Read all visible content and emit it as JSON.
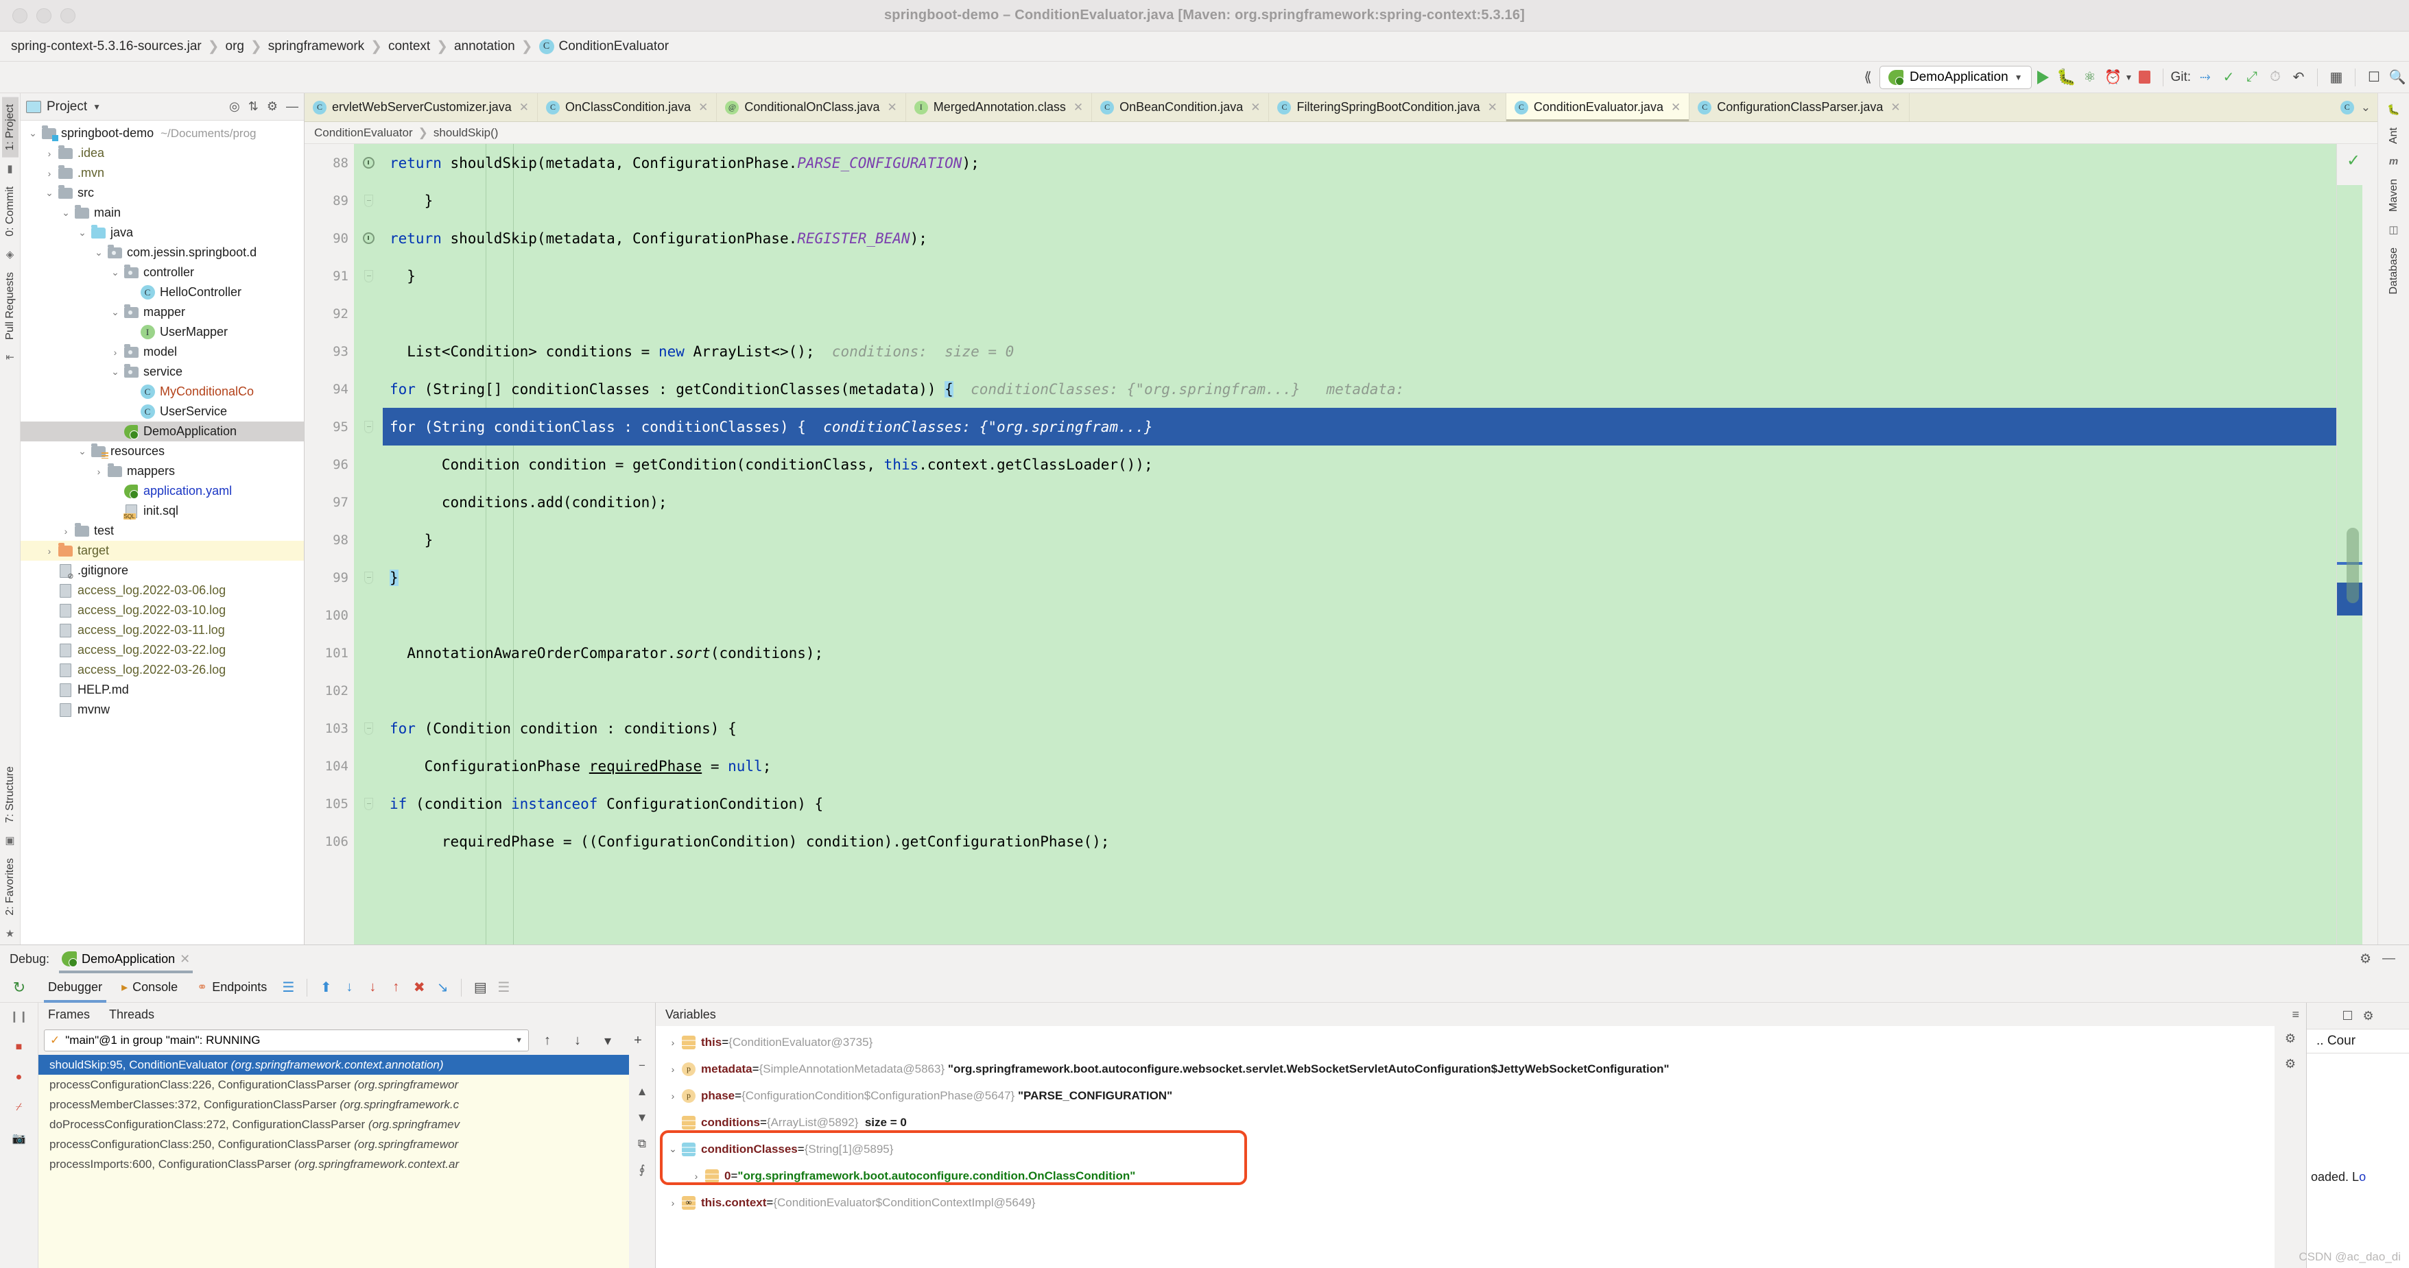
{
  "window": {
    "title": "springboot-demo – ConditionEvaluator.java [Maven: org.springframework:spring-context:5.3.16]"
  },
  "breadcrumb": {
    "items": [
      "spring-context-5.3.16-sources.jar",
      "org",
      "springframework",
      "context",
      "annotation",
      "ConditionEvaluator"
    ],
    "class_badge": "C"
  },
  "toolbar": {
    "run_config": "DemoApplication",
    "git_label": "Git:",
    "icons": {
      "run": "run-icon",
      "debug": "debug-icon",
      "run_coverage": "run-with-coverage-icon",
      "profile": "profiler-icon",
      "stop": "stop-icon",
      "update_project": "git-update-icon",
      "commit": "git-commit-icon",
      "push": "git-push-icon",
      "history": "git-history-icon",
      "rollback": "git-rollback-icon",
      "search": "search-everywhere-icon"
    }
  },
  "project_panel": {
    "title": "Project",
    "tree": [
      {
        "depth": 0,
        "arrow": "expanded",
        "icon": "folder-root",
        "label": "springboot-demo",
        "path": "~/Documents/prog",
        "state": "normal"
      },
      {
        "depth": 1,
        "arrow": "collapsed",
        "icon": "folder",
        "label": ".idea",
        "color": "olive",
        "state": "normal"
      },
      {
        "depth": 1,
        "arrow": "collapsed",
        "icon": "folder",
        "label": ".mvn",
        "color": "olive",
        "state": "normal"
      },
      {
        "depth": 1,
        "arrow": "expanded",
        "icon": "folder",
        "label": "src",
        "state": "normal"
      },
      {
        "depth": 2,
        "arrow": "expanded",
        "icon": "folder",
        "label": "main",
        "state": "normal"
      },
      {
        "depth": 3,
        "arrow": "expanded",
        "icon": "folder-source",
        "label": "java",
        "state": "normal"
      },
      {
        "depth": 4,
        "arrow": "expanded",
        "icon": "folder-package",
        "label": "com.jessin.springboot.d",
        "state": "normal"
      },
      {
        "depth": 5,
        "arrow": "expanded",
        "icon": "folder-package",
        "label": "controller",
        "state": "normal"
      },
      {
        "depth": 6,
        "arrow": "none",
        "icon": "class",
        "label": "HelloController",
        "state": "normal"
      },
      {
        "depth": 5,
        "arrow": "expanded",
        "icon": "folder-package",
        "label": "mapper",
        "state": "normal"
      },
      {
        "depth": 6,
        "arrow": "none",
        "icon": "interface",
        "label": "UserMapper",
        "state": "normal"
      },
      {
        "depth": 5,
        "arrow": "collapsed",
        "icon": "folder-package",
        "label": "model",
        "state": "normal"
      },
      {
        "depth": 5,
        "arrow": "expanded",
        "icon": "folder-package",
        "label": "service",
        "state": "normal"
      },
      {
        "depth": 6,
        "arrow": "none",
        "icon": "class",
        "label": "MyConditionalCo",
        "color": "red",
        "state": "normal"
      },
      {
        "depth": 6,
        "arrow": "none",
        "icon": "class",
        "label": "UserService",
        "state": "normal"
      },
      {
        "depth": 5,
        "arrow": "none",
        "icon": "spring-class",
        "label": "DemoApplication",
        "state": "selected"
      },
      {
        "depth": 3,
        "arrow": "expanded",
        "icon": "folder-resources",
        "label": "resources",
        "state": "normal"
      },
      {
        "depth": 4,
        "arrow": "collapsed",
        "icon": "folder",
        "label": "mappers",
        "state": "normal"
      },
      {
        "depth": 5,
        "arrow": "none",
        "icon": "spring-yaml",
        "label": "application.yaml",
        "color": "blue",
        "state": "normal"
      },
      {
        "depth": 5,
        "arrow": "none",
        "icon": "sql-file",
        "label": "init.sql",
        "state": "normal"
      },
      {
        "depth": 2,
        "arrow": "collapsed",
        "icon": "folder",
        "label": "test",
        "state": "normal"
      },
      {
        "depth": 1,
        "arrow": "collapsed",
        "icon": "folder-orange",
        "label": "target",
        "color": "olive",
        "state": "highlighted"
      },
      {
        "depth": 1,
        "arrow": "none",
        "icon": "gitignore-file",
        "label": ".gitignore",
        "state": "normal"
      },
      {
        "depth": 1,
        "arrow": "none",
        "icon": "log-file",
        "label": "access_log.2022-03-06.log",
        "color": "olive",
        "state": "normal"
      },
      {
        "depth": 1,
        "arrow": "none",
        "icon": "log-file",
        "label": "access_log.2022-03-10.log",
        "color": "olive",
        "state": "normal"
      },
      {
        "depth": 1,
        "arrow": "none",
        "icon": "log-file",
        "label": "access_log.2022-03-11.log",
        "color": "olive",
        "state": "normal"
      },
      {
        "depth": 1,
        "arrow": "none",
        "icon": "log-file",
        "label": "access_log.2022-03-22.log",
        "color": "olive",
        "state": "normal"
      },
      {
        "depth": 1,
        "arrow": "none",
        "icon": "log-file",
        "label": "access_log.2022-03-26.log",
        "color": "olive",
        "state": "normal"
      },
      {
        "depth": 1,
        "arrow": "none",
        "icon": "md-file",
        "label": "HELP.md",
        "state": "normal"
      },
      {
        "depth": 1,
        "arrow": "none",
        "icon": "file",
        "label": "mvnw",
        "state": "normal"
      }
    ]
  },
  "left_strip": {
    "tabs": [
      "1: Project",
      "0: Commit",
      "Pull Requests"
    ],
    "bottom_tabs": [
      "7: Structure",
      "2: Favorites"
    ]
  },
  "right_strip": {
    "tabs": [
      "Ant",
      "Maven",
      "Database"
    ]
  },
  "editor_tabs": [
    {
      "label": "ervletWebServerCustomizer.java",
      "icon": "class",
      "active": false
    },
    {
      "label": "OnClassCondition.java",
      "icon": "class",
      "active": false
    },
    {
      "label": "ConditionalOnClass.java",
      "icon": "annotation",
      "active": false
    },
    {
      "label": "MergedAnnotation.class",
      "icon": "interface",
      "active": false
    },
    {
      "label": "OnBeanCondition.java",
      "icon": "class",
      "active": false
    },
    {
      "label": "FilteringSpringBootCondition.java",
      "icon": "class",
      "active": false
    },
    {
      "label": "ConditionEvaluator.java",
      "icon": "class",
      "active": true
    },
    {
      "label": "ConfigurationClassParser.java",
      "icon": "class",
      "active": false
    }
  ],
  "editor_breadcrumb": [
    "ConditionEvaluator",
    "shouldSkip()"
  ],
  "code": {
    "lines": [
      {
        "num": "88",
        "gutter": "breakpoint",
        "text": "        return shouldSkip(metadata, ConfigurationPhase.PARSE_CONFIGURATION);",
        "tokens": [
          {
            "t": "        ",
            "c": "plain"
          },
          {
            "t": "return",
            "c": "kw"
          },
          {
            "t": " shouldSkip(metadata, ConfigurationPhase.",
            "c": "plain"
          },
          {
            "t": "PARSE_CONFIGURATION",
            "c": "stat"
          },
          {
            "t": ");",
            "c": "plain"
          }
        ]
      },
      {
        "num": "89",
        "gutter": "fold",
        "text": "    }",
        "tokens": [
          {
            "t": "    }",
            "c": "plain"
          }
        ]
      },
      {
        "num": "90",
        "gutter": "breakpoint",
        "text": "    return shouldSkip(metadata, ConfigurationPhase.REGISTER_BEAN);",
        "tokens": [
          {
            "t": "    ",
            "c": "plain"
          },
          {
            "t": "return",
            "c": "kw"
          },
          {
            "t": " shouldSkip(metadata, ConfigurationPhase.",
            "c": "plain"
          },
          {
            "t": "REGISTER_BEAN",
            "c": "stat"
          },
          {
            "t": ");",
            "c": "plain"
          }
        ]
      },
      {
        "num": "91",
        "gutter": "fold",
        "text": "  }",
        "tokens": [
          {
            "t": "  }",
            "c": "plain"
          }
        ]
      },
      {
        "num": "92",
        "gutter": "",
        "text": "",
        "tokens": []
      },
      {
        "num": "93",
        "gutter": "",
        "text": "  List<Condition> conditions = new ArrayList<>();",
        "tokens": [
          {
            "t": "  List<Condition> conditions = ",
            "c": "plain"
          },
          {
            "t": "new",
            "c": "kw"
          },
          {
            "t": " ArrayList<>();",
            "c": "plain"
          }
        ],
        "hint": "  conditions:  size = 0"
      },
      {
        "num": "94",
        "gutter": "",
        "text": "  for (String[] conditionClasses : getConditionClasses(metadata)) {",
        "tokens": [
          {
            "t": "  ",
            "c": "plain"
          },
          {
            "t": "for",
            "c": "kw"
          },
          {
            "t": " (String[] conditionClasses : getConditionClasses(metadata)) ",
            "c": "plain"
          },
          {
            "t": "{",
            "c": "brace"
          }
        ],
        "hint": "  conditionClasses: {\"org.springfram...}   metadata:"
      },
      {
        "num": "95",
        "gutter": "fold",
        "text": "    for (String conditionClass : conditionClasses) {",
        "tokens": [
          {
            "t": "    ",
            "c": "plain"
          },
          {
            "t": "for",
            "c": "kw"
          },
          {
            "t": " (String conditionClass : conditionClasses) {",
            "c": "plain"
          }
        ],
        "hint": "  conditionClasses: {\"org.springfram...}",
        "current": true
      },
      {
        "num": "96",
        "gutter": "",
        "text": "      Condition condition = getCondition(conditionClass, this.context.getClassLoader());",
        "tokens": [
          {
            "t": "      Condition condition = getCondition(conditionClass, ",
            "c": "plain"
          },
          {
            "t": "this",
            "c": "kw"
          },
          {
            "t": ".context.getClassLoader());",
            "c": "plain"
          }
        ]
      },
      {
        "num": "97",
        "gutter": "",
        "text": "      conditions.add(condition);",
        "tokens": [
          {
            "t": "      conditions.add(condition);",
            "c": "plain"
          }
        ]
      },
      {
        "num": "98",
        "gutter": "",
        "text": "    }",
        "tokens": [
          {
            "t": "    }",
            "c": "plain"
          }
        ]
      },
      {
        "num": "99",
        "gutter": "fold",
        "text": "  }",
        "tokens": [
          {
            "t": "  ",
            "c": "plain"
          },
          {
            "t": "}",
            "c": "brace"
          }
        ]
      },
      {
        "num": "100",
        "gutter": "",
        "text": "",
        "tokens": []
      },
      {
        "num": "101",
        "gutter": "",
        "text": "  AnnotationAwareOrderComparator.sort(conditions);",
        "tokens": [
          {
            "t": "  AnnotationAwareOrderComparator.",
            "c": "plain"
          },
          {
            "t": "sort",
            "c": "ital"
          },
          {
            "t": "(conditions);",
            "c": "plain"
          }
        ]
      },
      {
        "num": "102",
        "gutter": "",
        "text": "",
        "tokens": []
      },
      {
        "num": "103",
        "gutter": "fold",
        "text": "  for (Condition condition : conditions) {",
        "tokens": [
          {
            "t": "  ",
            "c": "plain"
          },
          {
            "t": "for",
            "c": "kw"
          },
          {
            "t": " (Condition condition : conditions) {",
            "c": "plain"
          }
        ]
      },
      {
        "num": "104",
        "gutter": "",
        "text": "    ConfigurationPhase requiredPhase = null;",
        "tokens": [
          {
            "t": "    ConfigurationPhase ",
            "c": "plain"
          },
          {
            "t": "requiredPhase",
            "c": "uline"
          },
          {
            "t": " = ",
            "c": "plain"
          },
          {
            "t": "null",
            "c": "kw"
          },
          {
            "t": ";",
            "c": "plain"
          }
        ]
      },
      {
        "num": "105",
        "gutter": "fold",
        "text": "    if (condition instanceof ConfigurationCondition) {",
        "tokens": [
          {
            "t": "    ",
            "c": "plain"
          },
          {
            "t": "if",
            "c": "kw"
          },
          {
            "t": " (condition ",
            "c": "plain"
          },
          {
            "t": "instanceof",
            "c": "kw"
          },
          {
            "t": " ConfigurationCondition) {",
            "c": "plain"
          }
        ]
      },
      {
        "num": "106",
        "gutter": "",
        "text": "      requiredPhase = ((ConfigurationCondition) condition).getConfigurationPhase();",
        "tokens": [
          {
            "t": "      requiredPhase = ((ConfigurationCondition) condition).getConfigurationPhase();",
            "c": "plain"
          }
        ]
      }
    ]
  },
  "debug": {
    "header_label": "Debug:",
    "session_name": "DemoApplication",
    "tabs": [
      {
        "label": "Debugger",
        "icon": "debugger-icon",
        "active": true
      },
      {
        "label": "Console",
        "icon": "console-icon",
        "active": false
      },
      {
        "label": "Endpoints",
        "icon": "endpoints-icon",
        "active": false
      }
    ],
    "step_icons": [
      "show-execution-point",
      "step-over",
      "step-into",
      "force-step-into",
      "step-out",
      "drop-frame",
      "run-to-cursor",
      "evaluate-expression",
      "settings"
    ],
    "frames_header": "Frames",
    "threads_header": "Threads",
    "thread": "\"main\"@1 in group \"main\": RUNNING",
    "frames": [
      {
        "method": "shouldSkip:95, ConditionEvaluator",
        "pkg": "(org.springframework.context.annotation)",
        "selected": true
      },
      {
        "method": "processConfigurationClass:226, ConfigurationClassParser",
        "pkg": "(org.springframewor",
        "selected": false
      },
      {
        "method": "processMemberClasses:372, ConfigurationClassParser",
        "pkg": "(org.springframework.c",
        "selected": false
      },
      {
        "method": "doProcessConfigurationClass:272, ConfigurationClassParser",
        "pkg": "(org.springframev",
        "selected": false
      },
      {
        "method": "processConfigurationClass:250, ConfigurationClassParser",
        "pkg": "(org.springframewor",
        "selected": false
      },
      {
        "method": "processImports:600, ConfigurationClassParser",
        "pkg": "(org.springframework.context.ar",
        "selected": false
      }
    ],
    "variables_header": "Variables",
    "variables": [
      {
        "arrow": "collapsed",
        "badge": "field",
        "name": "this",
        "eq": " = ",
        "type": "{ConditionEvaluator@3735}",
        "value": "",
        "indent": 0
      },
      {
        "arrow": "collapsed",
        "badge": "param",
        "name": "metadata",
        "eq": " = ",
        "type": "{SimpleAnnotationMetadata@5863}",
        "value": "\"org.springframework.boot.autoconfigure.websocket.servlet.WebSocketServletAutoConfiguration$JettyWebSocketConfiguration\"",
        "indent": 0
      },
      {
        "arrow": "collapsed",
        "badge": "param",
        "name": "phase",
        "eq": " = ",
        "type": "{ConfigurationCondition$ConfigurationPhase@5647}",
        "value": "\"PARSE_CONFIGURATION\"",
        "indent": 0
      },
      {
        "arrow": "none",
        "badge": "field",
        "name": "conditions",
        "eq": " = ",
        "type": "{ArrayList@5892}",
        "size": "size = 0",
        "indent": 0
      },
      {
        "arrow": "expanded",
        "badge": "arr",
        "name": "conditionClasses",
        "eq": " = ",
        "type": "{String[1]@5895}",
        "value": "",
        "indent": 0,
        "highlighted": true
      },
      {
        "arrow": "collapsed",
        "badge": "field",
        "name": "0",
        "eq": " = ",
        "type": "",
        "green": "\"org.springframework.boot.autoconfigure.condition.OnClassCondition\"",
        "indent": 1,
        "highlighted": true
      },
      {
        "arrow": "collapsed",
        "badge": "watch",
        "name": "this.context",
        "eq": " = ",
        "type": "{ConditionEvaluator$ConditionContextImpl@5649}",
        "value": "",
        "indent": 0
      }
    ],
    "right_dock": {
      "tab": ".. Cour",
      "note_text": "oaded. L",
      "note_link": "o"
    }
  },
  "watermark": "CSDN @ac_dao_di",
  "colors": {
    "accent_blue": "#2b5ca8",
    "editor_green": "#c9ebc9",
    "tab_yellow": "#ecebd8",
    "highlight_red": "#ef4a21",
    "frames_bg": "#fdfce8"
  }
}
